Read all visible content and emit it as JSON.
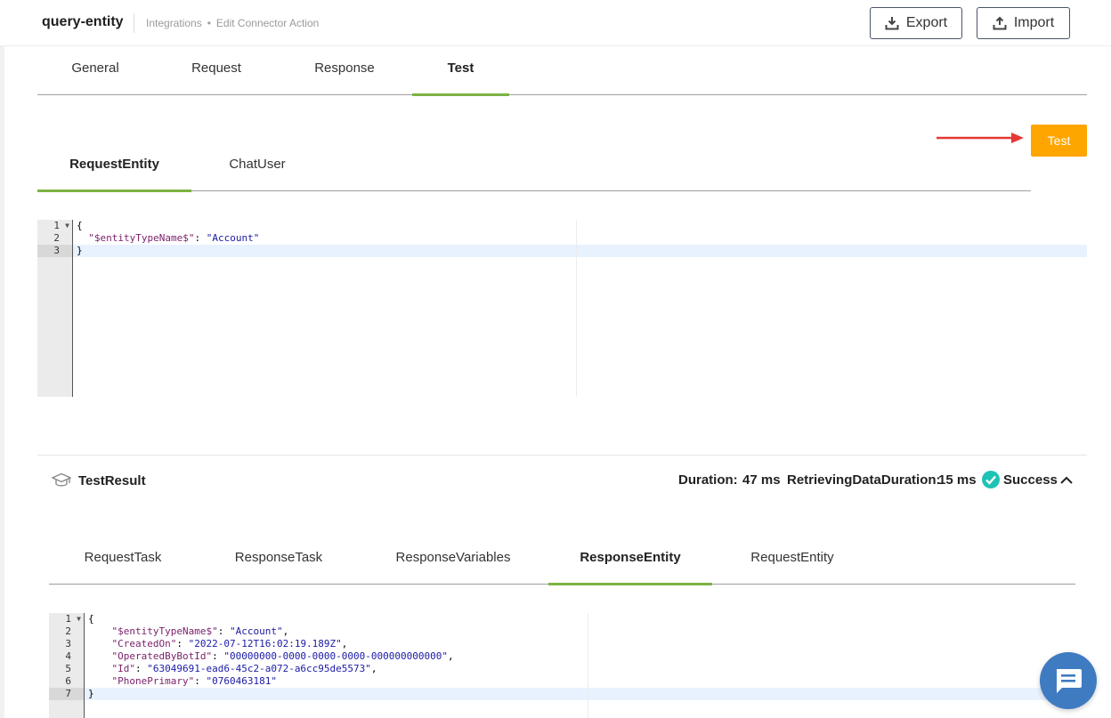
{
  "header": {
    "title": "query-entity",
    "breadcrumb": [
      "Integrations",
      "Edit Connector Action"
    ],
    "breadcrumb_sep": "•",
    "export_label": "Export",
    "import_label": "Import"
  },
  "main_tabs": {
    "items": [
      "General",
      "Request",
      "Response",
      "Test"
    ],
    "active": "Test"
  },
  "test_button_label": "Test",
  "request_tabs": {
    "items": [
      "RequestEntity",
      "ChatUser"
    ],
    "active": "RequestEntity"
  },
  "request_editor": {
    "lines": [
      {
        "num": "1",
        "text": "{"
      },
      {
        "num": "2",
        "key": "\"$entityTypeName$\"",
        "sep": ": ",
        "value": "\"Account\"",
        "indent": "  "
      },
      {
        "num": "3",
        "text": "}"
      }
    ]
  },
  "test_result": {
    "title": "TestResult",
    "duration_label": "Duration:",
    "duration_value": "47 ms",
    "retrieving_label": "RetrievingDataDuration:",
    "retrieving_value": "15 ms",
    "status": "Success",
    "status_color": "#1ec3b5"
  },
  "result_tabs": {
    "items": [
      "RequestTask",
      "ResponseTask",
      "ResponseVariables",
      "ResponseEntity",
      "RequestEntity"
    ],
    "active": "ResponseEntity"
  },
  "response_editor": {
    "lines": [
      {
        "num": "1",
        "text": "{"
      },
      {
        "num": "2",
        "key": "\"$entityTypeName$\"",
        "sep": ": ",
        "value": "\"Account\"",
        "trail": ",",
        "indent": "    "
      },
      {
        "num": "3",
        "key": "\"CreatedOn\"",
        "sep": ": ",
        "value": "\"2022-07-12T16:02:19.189Z\"",
        "trail": ",",
        "indent": "    "
      },
      {
        "num": "4",
        "key": "\"OperatedByBotId\"",
        "sep": ": ",
        "value": "\"00000000-0000-0000-0000-000000000000\"",
        "trail": ",",
        "indent": "    "
      },
      {
        "num": "5",
        "key": "\"Id\"",
        "sep": ": ",
        "value": "\"63049691-ead6-45c2-a072-a6cc95de5573\"",
        "trail": ",",
        "indent": "    "
      },
      {
        "num": "6",
        "key": "\"PhonePrimary\"",
        "sep": ": ",
        "value": "\"0760463181\"",
        "indent": "    "
      },
      {
        "num": "7",
        "text": "}"
      }
    ]
  },
  "colors": {
    "accent_green": "#7cb342",
    "test_button": "#ffa500",
    "chat_fab": "#3f7bc1"
  }
}
